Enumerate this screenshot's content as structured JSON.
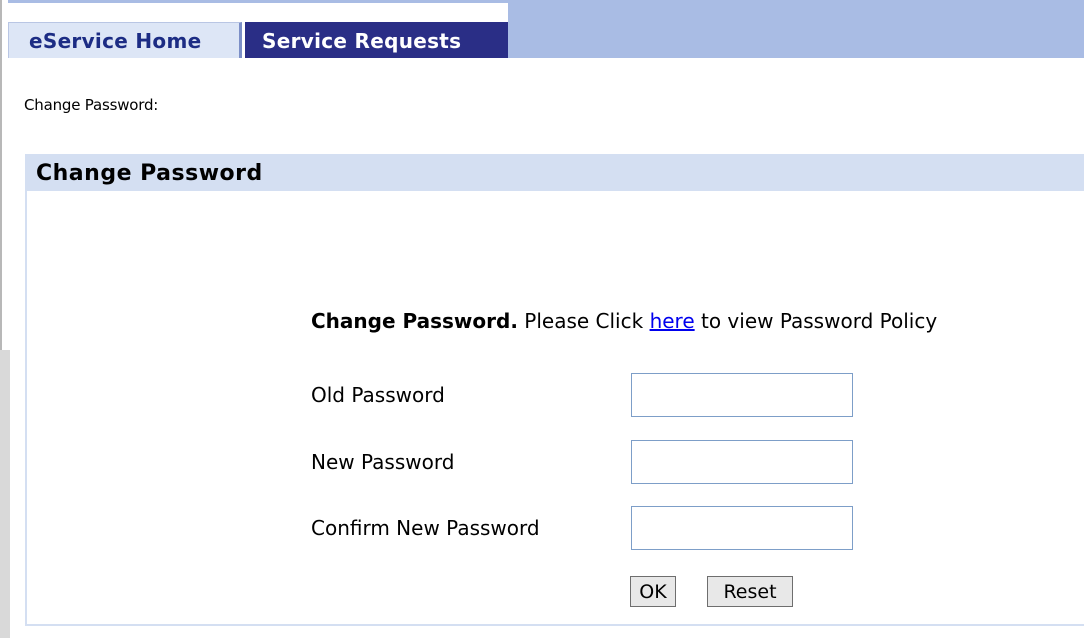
{
  "tabs": [
    {
      "label": "eService Home",
      "active": false
    },
    {
      "label": "Service Requests",
      "active": true
    }
  ],
  "breadcrumb": "Change Password:",
  "panel": {
    "title": "Change Password"
  },
  "form": {
    "intro_bold": "Change Password.",
    "intro_pre_link": " Please Click ",
    "intro_link": "here",
    "intro_post_link": " to view Password Policy",
    "fields": [
      {
        "label": "Old Password",
        "value": ""
      },
      {
        "label": "New Password",
        "value": ""
      },
      {
        "label": "Confirm New Password",
        "value": ""
      }
    ],
    "ok_label": "OK",
    "reset_label": "Reset"
  },
  "colors": {
    "tab_bar": "#a9bce4",
    "active_tab": "#2a2e86",
    "inactive_tab": "#dde6f6",
    "panel_header": "#d4dff2",
    "link": "#0000ee"
  }
}
